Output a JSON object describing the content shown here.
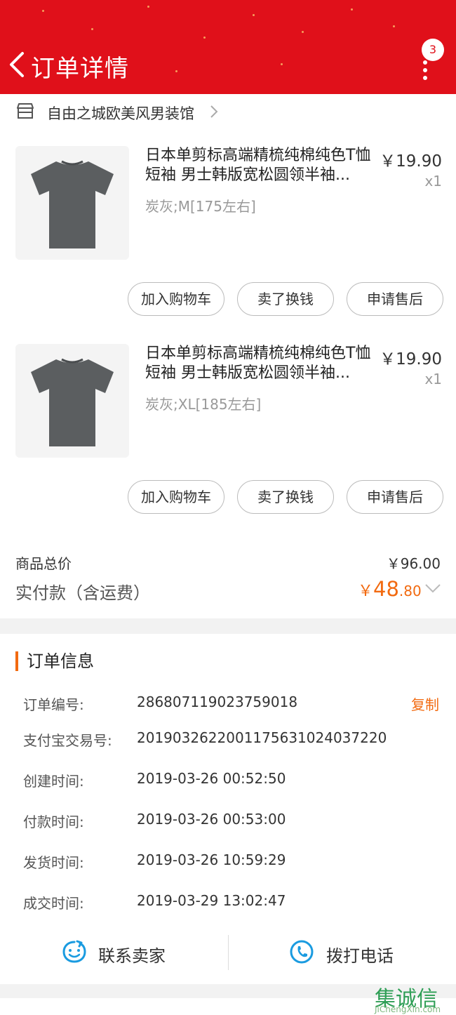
{
  "header": {
    "title": "订单详情",
    "badge_count": "3"
  },
  "shop": {
    "name": "自由之城欧美风男装馆"
  },
  "products": [
    {
      "name": "日本单剪标高端精梳纯棉纯色T恤短袖 男士韩版宽松圆领半袖...",
      "sku": "炭灰;M[175左右]",
      "price": "￥19.90",
      "qty": "x1",
      "buttons": [
        "加入购物车",
        "卖了换钱",
        "申请售后"
      ]
    },
    {
      "name": "日本单剪标高端精梳纯棉纯色T恤短袖 男士韩版宽松圆领半袖...",
      "sku": "炭灰;XL[185左右]",
      "price": "￥19.90",
      "qty": "x1",
      "buttons": [
        "加入购物车",
        "卖了换钱",
        "申请售后"
      ]
    }
  ],
  "totals": {
    "goods_label": "商品总价",
    "goods_value": "￥96.00",
    "paid_label": "实付款（含运费）",
    "paid_currency": "￥",
    "paid_int": "48",
    "paid_dec": ".80"
  },
  "order_info": {
    "title": "订单信息",
    "copy_label": "复制",
    "rows": [
      {
        "label": "订单编号:",
        "value": "286807119023759018"
      },
      {
        "label": "支付宝交易号:",
        "value": "2019032622001175631024037220"
      },
      {
        "label": "创建时间:",
        "value": "2019-03-26 00:52:50"
      },
      {
        "label": "付款时间:",
        "value": "2019-03-26 00:53:00"
      },
      {
        "label": "发货时间:",
        "value": "2019-03-26 10:59:29"
      },
      {
        "label": "成交时间:",
        "value": "2019-03-29 13:02:47"
      }
    ]
  },
  "contact": {
    "seller_label": "联系卖家",
    "phone_label": "拨打电话"
  },
  "watermark": {
    "text": "集诚信",
    "url": "JiChengXin.com"
  },
  "colors": {
    "header_red": "#e0101a",
    "accent_orange": "#f26a10",
    "icon_blue": "#1a9be0"
  }
}
